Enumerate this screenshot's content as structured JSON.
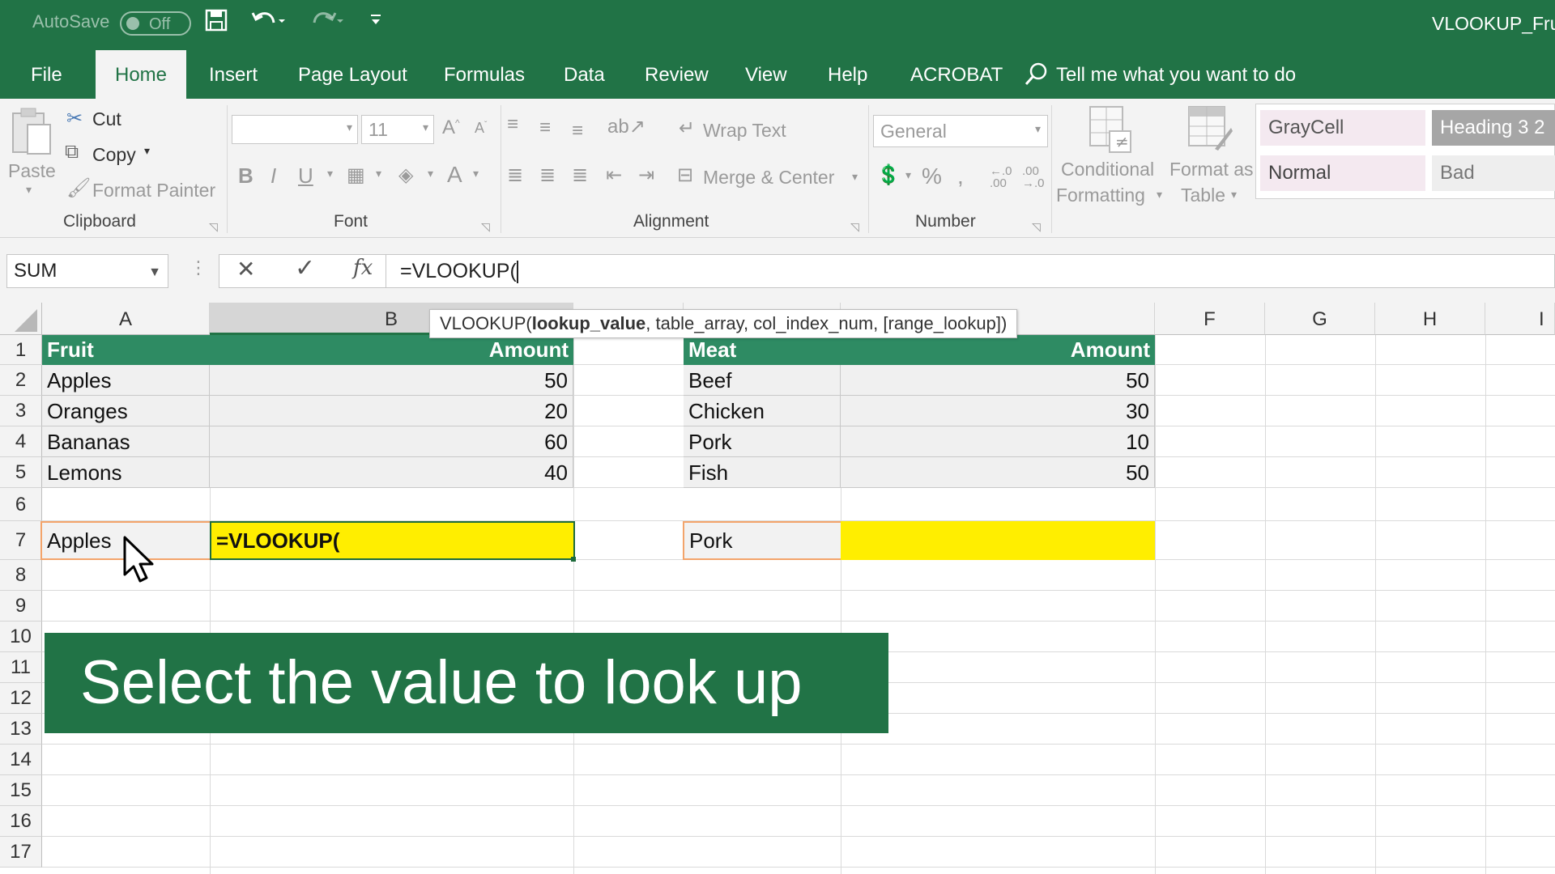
{
  "titlebar": {
    "autosave_label": "AutoSave",
    "autosave_state": "Off",
    "file_title": "VLOOKUP_Frui"
  },
  "tabs": [
    "File",
    "Home",
    "Insert",
    "Page Layout",
    "Formulas",
    "Data",
    "Review",
    "View",
    "Help",
    "ACROBAT"
  ],
  "active_tab": "Home",
  "tell_me": "Tell me what you want to do",
  "ribbon": {
    "clipboard": {
      "paste": "Paste",
      "cut": "Cut",
      "copy": "Copy",
      "format_painter": "Format Painter",
      "label": "Clipboard"
    },
    "font": {
      "size": "11",
      "label": "Font"
    },
    "alignment": {
      "wrap_text": "Wrap Text",
      "merge_center": "Merge & Center",
      "label": "Alignment"
    },
    "number": {
      "format": "General",
      "label": "Number"
    },
    "styles": {
      "conditional_formatting_1": "Conditional",
      "conditional_formatting_2": "Formatting",
      "format_as_table_1": "Format as",
      "format_as_table_2": "Table",
      "graycell": "GrayCell",
      "heading3": "Heading 3 2",
      "normal": "Normal",
      "bad": "Bad"
    }
  },
  "formula_bar": {
    "name_box": "SUM",
    "formula": "=VLOOKUP("
  },
  "tooltip": {
    "func": "VLOOKUP(",
    "bold_arg": "lookup_value",
    "rest": ", table_array, col_index_num, [range_lookup])"
  },
  "columns": [
    "A",
    "B",
    "F",
    "G",
    "H",
    "I"
  ],
  "rows": [
    "1",
    "2",
    "3",
    "4",
    "5",
    "6",
    "7",
    "8",
    "9",
    "10",
    "11",
    "12",
    "13",
    "14",
    "15",
    "16",
    "17"
  ],
  "fruit_table": {
    "header": [
      "Fruit",
      "Amount"
    ],
    "rows": [
      [
        "Apples",
        "50"
      ],
      [
        "Oranges",
        "20"
      ],
      [
        "Bananas",
        "60"
      ],
      [
        "Lemons",
        "40"
      ]
    ]
  },
  "meat_table": {
    "header": [
      "Meat",
      "Amount"
    ],
    "rows": [
      [
        "Beef",
        "50"
      ],
      [
        "Chicken",
        "30"
      ],
      [
        "Pork",
        "10"
      ],
      [
        "Fish",
        "50"
      ]
    ]
  },
  "lookup": {
    "fruit_value": "Apples",
    "fruit_formula": "=VLOOKUP(",
    "meat_value": "Pork"
  },
  "colors": {
    "excel_green": "#217346",
    "header_green": "#2e8b63",
    "highlight_yellow": "#ffee00",
    "select_orange": "#f3a46b"
  },
  "banner": "Select the value to look up"
}
